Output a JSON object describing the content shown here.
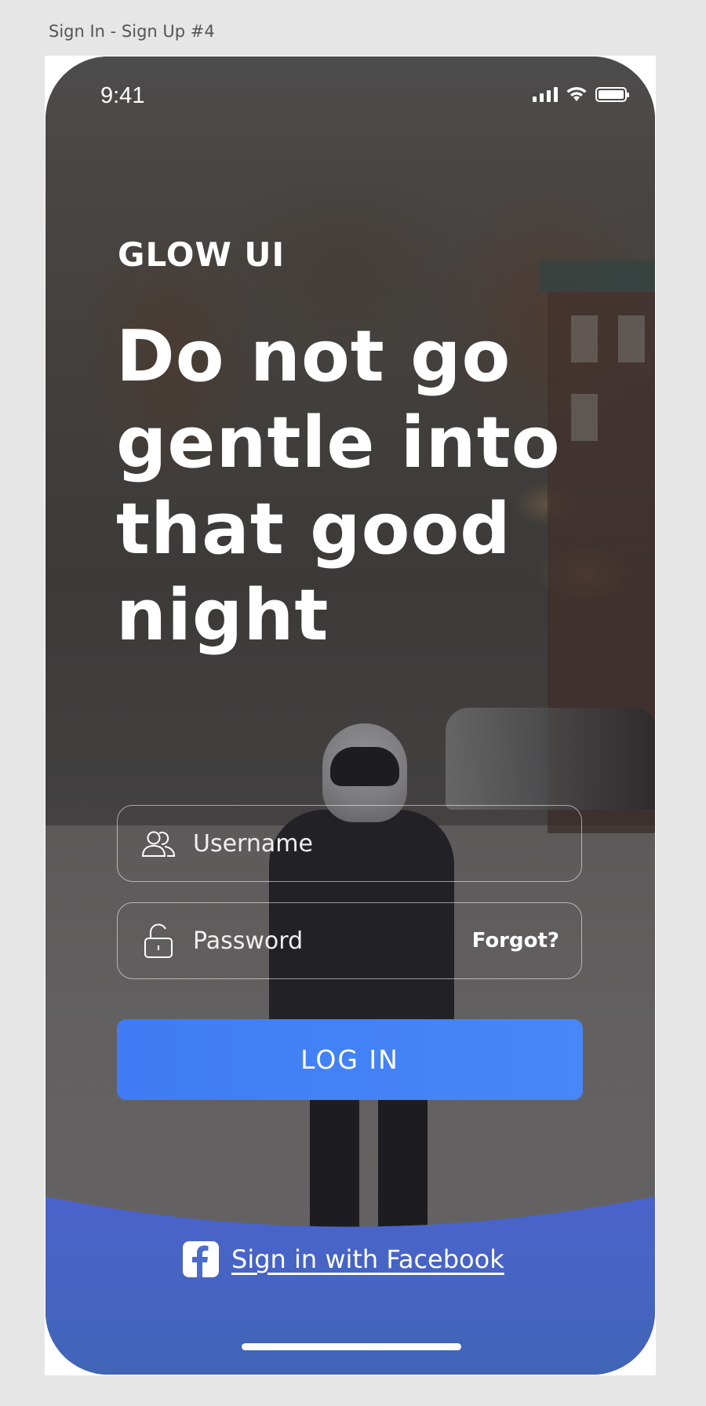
{
  "artboard": {
    "label": "Sign In - Sign Up #4"
  },
  "status_bar": {
    "time": "9:41"
  },
  "brand": {
    "name": "GLOW UI"
  },
  "headline": {
    "text": "Do not go gentle into that good night"
  },
  "username": {
    "placeholder": "Username",
    "icon": "users-icon"
  },
  "password": {
    "placeholder": "Password",
    "icon": "unlock-icon",
    "forgot_label": "Forgot?"
  },
  "login": {
    "label": "LOG IN",
    "color": "#4282f6"
  },
  "facebook": {
    "label": "Sign in with Facebook",
    "icon": "facebook-icon",
    "panel_color": "#4a6ccc"
  }
}
